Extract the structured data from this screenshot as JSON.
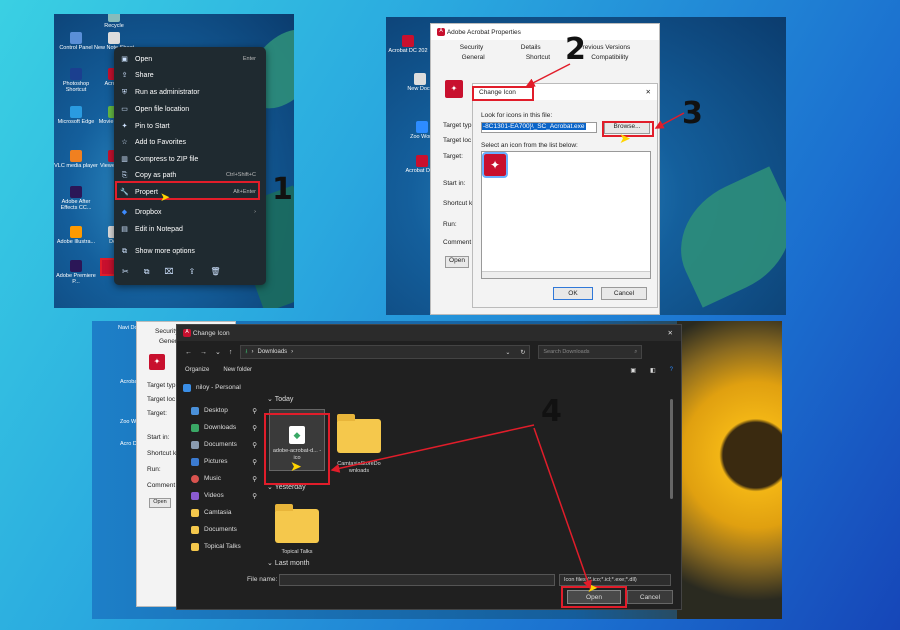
{
  "step_numbers": [
    "1",
    "2",
    "3",
    "4"
  ],
  "panel1": {
    "desktop_icons": [
      "Recycle",
      "Control Panel",
      "New Note Sheet",
      "Photoshop Shortcut",
      "Acrobat",
      "Microsoft Edge",
      "Movie Editor",
      "VLC media player",
      "Viewer Doc",
      "Adobe After Effects CC...",
      "Adobe Illustra...",
      "Doc",
      "Adobe Premiere P..."
    ],
    "context_menu": [
      {
        "label": "Open",
        "shortcut": "Enter",
        "icon": "open-icon"
      },
      {
        "label": "Share",
        "shortcut": "",
        "icon": "share-icon"
      },
      {
        "label": "Run as administrator",
        "shortcut": "",
        "icon": "shield-icon"
      },
      {
        "label": "Open file location",
        "shortcut": "",
        "icon": "folder-icon"
      },
      {
        "label": "Pin to Start",
        "shortcut": "",
        "icon": "pin-icon"
      },
      {
        "label": "Add to Favorites",
        "shortcut": "",
        "icon": "star-icon"
      },
      {
        "label": "Compress to ZIP file",
        "shortcut": "",
        "icon": "zip-icon"
      },
      {
        "label": "Copy as path",
        "shortcut": "Ctrl+Shift+C",
        "icon": "copy-path-icon"
      },
      {
        "label": "Properties",
        "shortcut": "Alt+Enter",
        "icon": "wrench-icon"
      },
      {
        "label": "Dropbox",
        "shortcut": "",
        "icon": "dropbox-icon"
      },
      {
        "label": "Edit in Notepad",
        "shortcut": "",
        "icon": "notepad-icon"
      },
      {
        "label": "Show more options",
        "shortcut": "",
        "icon": "more-options-icon"
      }
    ],
    "properties_display": "Propert"
  },
  "panel2": {
    "props_title": "Adobe Acrobat Properties",
    "tabs_row1": [
      "Security",
      "Details",
      "Previous Versions"
    ],
    "tabs_row2": [
      "General",
      "Shortcut",
      "Compatibility"
    ],
    "left_labels": [
      "Target typ",
      "Target loc",
      "Target:",
      "Start in:",
      "Shortcut k",
      "Run:",
      "Comment"
    ],
    "open_btn": "Open",
    "change_icon_title": "Change Icon",
    "look_label": "Look for icons in this file:",
    "path_value": "-8C1301-EA700}\\_SC_Acrobat.exe",
    "browse": "Browse...",
    "select_label": "Select an icon from the list below:",
    "ok": "OK",
    "cancel": "Cancel",
    "bg_texts": [
      "Acrobat DC 202",
      "New Docu",
      "Zoo Work",
      "Acrobat DC 2"
    ]
  },
  "panel3": {
    "title": "Change Icon",
    "address": "Downloads",
    "search_placeholder": "Search Downloads",
    "organize": "Organize",
    "new_folder": "New folder",
    "nav_items": [
      {
        "label": "niloy - Personal",
        "pin": false,
        "color": "#3a8ee6"
      },
      {
        "label": "Desktop",
        "pin": true,
        "color": "#4a90d9"
      },
      {
        "label": "Downloads",
        "pin": true,
        "color": "#3aa866"
      },
      {
        "label": "Documents",
        "pin": true,
        "color": "#8a9bb0"
      },
      {
        "label": "Pictures",
        "pin": true,
        "color": "#3b7bd1"
      },
      {
        "label": "Music",
        "pin": true,
        "color": "#d9534f"
      },
      {
        "label": "Videos",
        "pin": true,
        "color": "#8a5bd1"
      },
      {
        "label": "Camtasia",
        "pin": false,
        "color": "#f5c84c"
      },
      {
        "label": "Documents",
        "pin": false,
        "color": "#f5c84c"
      },
      {
        "label": "Topical Talks",
        "pin": false,
        "color": "#f5c84c"
      }
    ],
    "groups": [
      "Today",
      "Yesterday",
      "Last month"
    ],
    "files": [
      "adobe-acrobat-dc-icon.ico",
      "CamtasiaStoreDownloads",
      "Topical Talks"
    ],
    "file_label_1": "adobe-acrobat-d... -ico",
    "file_label_2": "CamtasiaStoreDo wnloads",
    "filename_label": "File name:",
    "filetype": "Icon files (*.ico;*.icl;*.exe;*.dll)",
    "open": "Open",
    "cancel": "Cancel",
    "bg_left": [
      "Security",
      "Gener",
      "Target typ",
      "Target loc",
      "Target:",
      "Start in:",
      "Shortcut k",
      "Run:",
      "Comment",
      "Open"
    ],
    "bg_desktop": [
      "Navi Docu",
      "Acroba DC 2",
      "Zoo Work",
      "Acro DC 2"
    ]
  }
}
